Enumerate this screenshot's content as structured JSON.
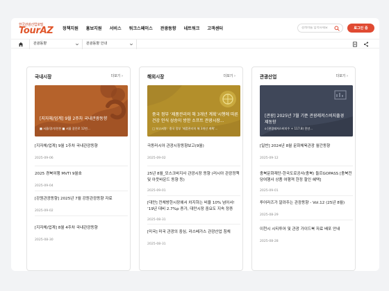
{
  "header": {
    "logo_top": "한국관광산업포털",
    "logo_main": "TourAZ",
    "nav": [
      "정책지원",
      "홍보지원",
      "서비스",
      "워크스페이스",
      "관광동향",
      "네트워크",
      "고객센터"
    ],
    "search_placeholder": "검색어를 입력하세요",
    "login_label": "로그인 중"
  },
  "breadcrumb": {
    "first": "관광동향",
    "second": "관광동향 안내"
  },
  "colors": {
    "accent": "#e04a32",
    "brand": "#e0562b"
  },
  "columns": [
    {
      "title": "국내시장",
      "more": "더보기",
      "banner": {
        "title": "[지자체/업계] 9월 2주차 국내관광동향",
        "sub": "■ 서울/경기/인천 ■ 서울 광진로 12번..."
      },
      "items": [
        {
          "title": "[지자체/업계] 9월 1주차 국내관광동향",
          "date": "2025-09-06"
        },
        {
          "title": "2025 경북여행 MVTI 9월호",
          "date": "2025-09-04"
        },
        {
          "title": "[강원관광동향] 2025년 7월 강원관광동향 자료",
          "date": "2025-09-02"
        },
        {
          "title": "[지자체/업계] 8월 4주차 국내관광동향",
          "date": "2025-08-30"
        }
      ]
    },
    {
      "title": "해외시장",
      "more": "더보기",
      "banner": {
        "title": "중국 정부 ‘제품관리의 해 3개년 계획’시행에 따른 건강 인식 상승이 방한 소프트 관광시장...",
        "sub": "□ 보고서명 : 중국 정부 '제품관리의 해 3개년 계획'..."
      },
      "items": [
        {
          "title": "극동러시아 관광시장동향보고(9월)",
          "date": "2025-09-02"
        },
        {
          "title": "25년 8월_모스크바지사 관광시장 동향 (러시아 관광정책 및 아웃바운드 동향 등)",
          "date": "2025-09-01"
        },
        {
          "title": "[대만] 전체방한시장에서 차지하는 비율 10% 넘어서! ‘19년 대비 2.7%p 증가, 대만시장 중요도 지속 정증",
          "date": "2025-08-31"
        },
        {
          "title": "[미국] 미국 관광의 중심, 라스베가스 관광산업 침체",
          "date": "2025-08-31"
        }
      ]
    },
    {
      "title": "관광산업",
      "more": "더보기",
      "banner": {
        "title": "[관광] 2025년 7월 기준 관광레저스비지출경제동향",
        "sub": "o [관광레저스비지수 + 117.8) 전년..."
      },
      "items": [
        {
          "title": "[일반] 2024년 8월 문화체육관광 월간동향",
          "date": "2025-09-12"
        },
        {
          "title": "충북문화재단-한국도로공사(충북) 들르GOPASS [충북전당여행사 상품 여행객 한정 할인 혜택]",
          "date": "2025-09-01"
        },
        {
          "title": "투어라즈가 알려주는 관광동향 - Vol.12 (25년 8월)",
          "date": "2025-08-29"
        },
        {
          "title": "이천시 시티투어 및 관광 가이드북 자료 배포 안내",
          "date": "2025-08-28"
        }
      ]
    }
  ]
}
